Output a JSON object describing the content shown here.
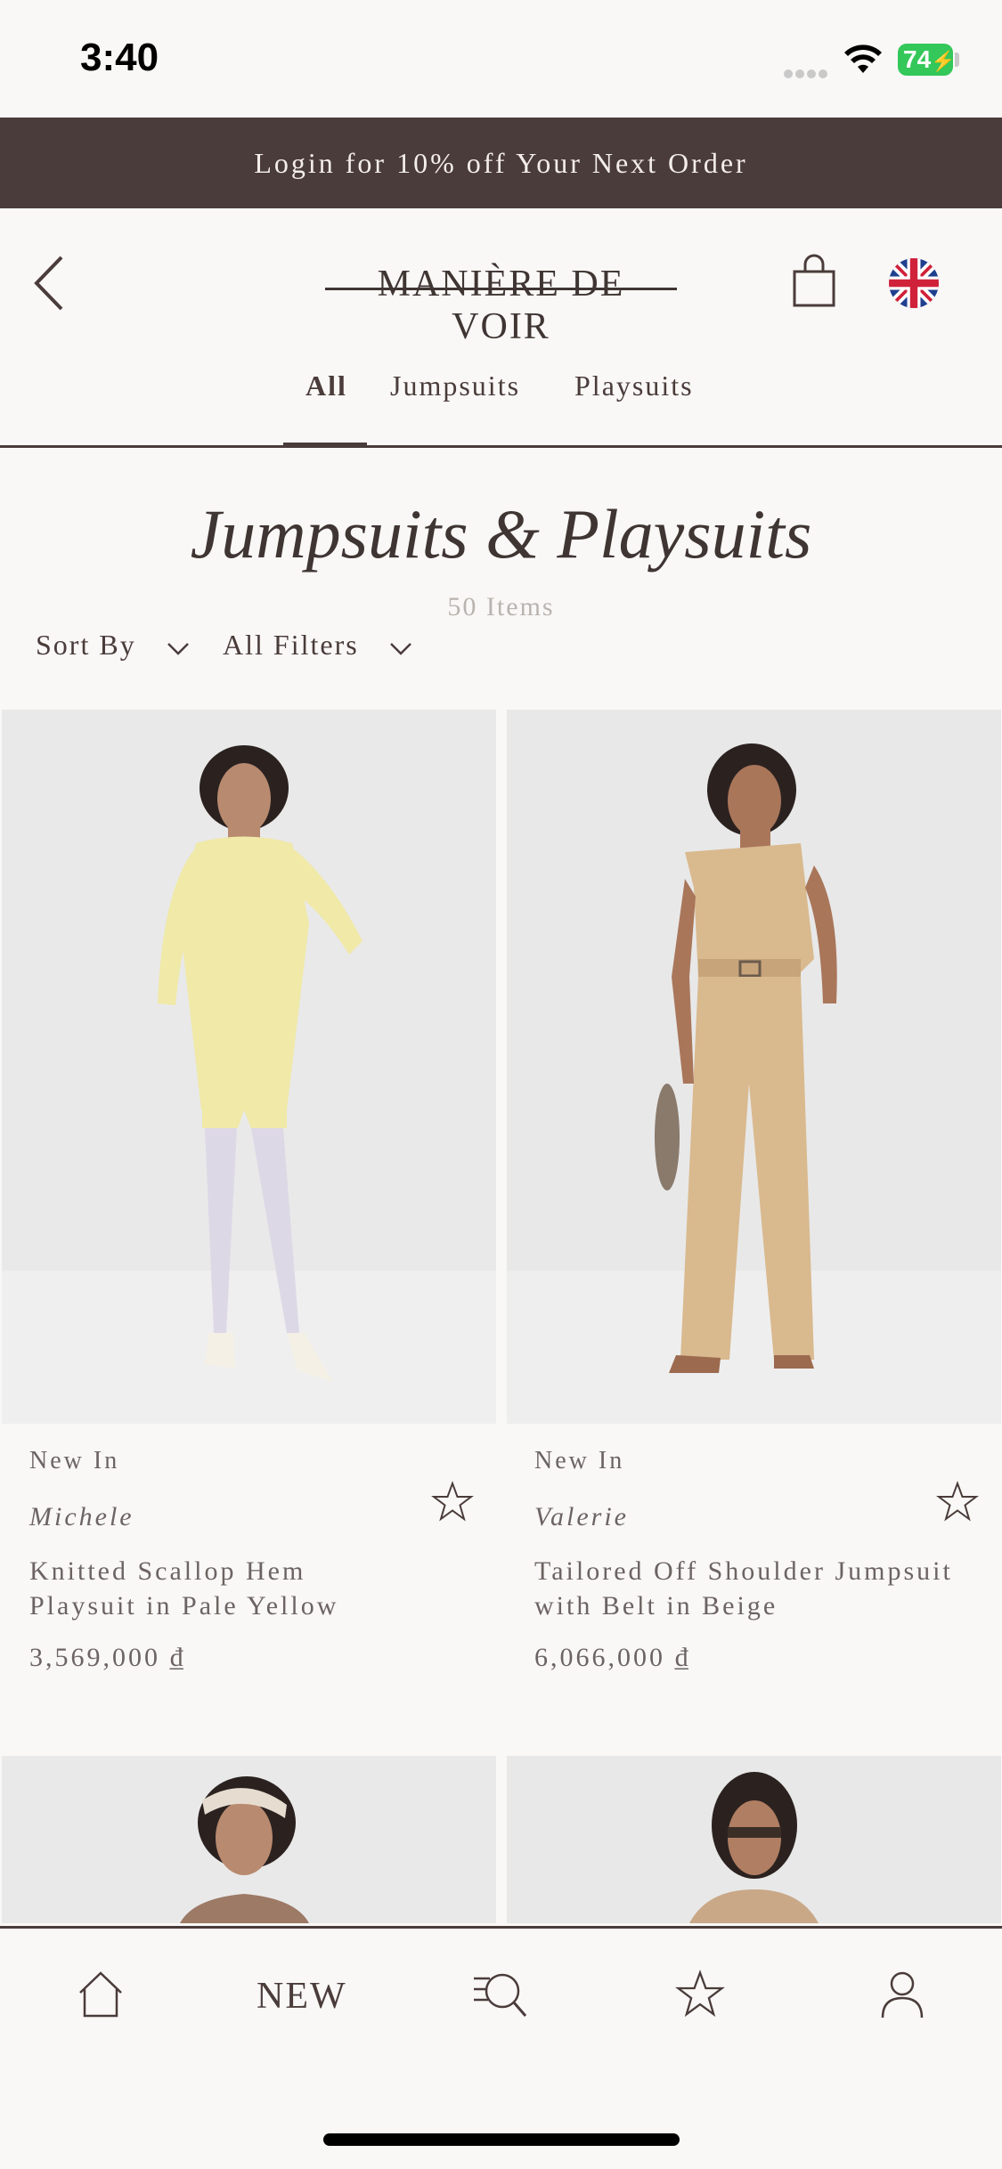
{
  "status_bar": {
    "time": "3:40",
    "battery": "74"
  },
  "promo": {
    "text": "Login for 10% off Your Next Order"
  },
  "header": {
    "logo": "MANIÈRE DE VOIR"
  },
  "tabs": [
    {
      "label": "All",
      "active": true
    },
    {
      "label": "Jumpsuits",
      "active": false
    },
    {
      "label": "Playsuits",
      "active": false
    }
  ],
  "page": {
    "title": "Jumpsuits & Playsuits",
    "count": "50 Items"
  },
  "toolbar": {
    "sort_label": "Sort By",
    "filters_label": "All Filters"
  },
  "products": [
    {
      "badge": "New In",
      "designer": "Michele",
      "name": "Knitted Scallop Hem Playsuit in Pale Yellow",
      "price": "3,569,000 ₫",
      "color": "#f0e9a8"
    },
    {
      "badge": "New In",
      "designer": "Valerie",
      "name": "Tailored Off Shoulder Jumpsuit with Belt in Beige",
      "price": "6,066,000 ₫",
      "color": "#d9b98e"
    }
  ],
  "bottom_nav": {
    "new_label": "NEW"
  },
  "colors": {
    "brand_dark": "#4a3c3a",
    "background": "#f9f8f6",
    "battery": "#34c759"
  }
}
